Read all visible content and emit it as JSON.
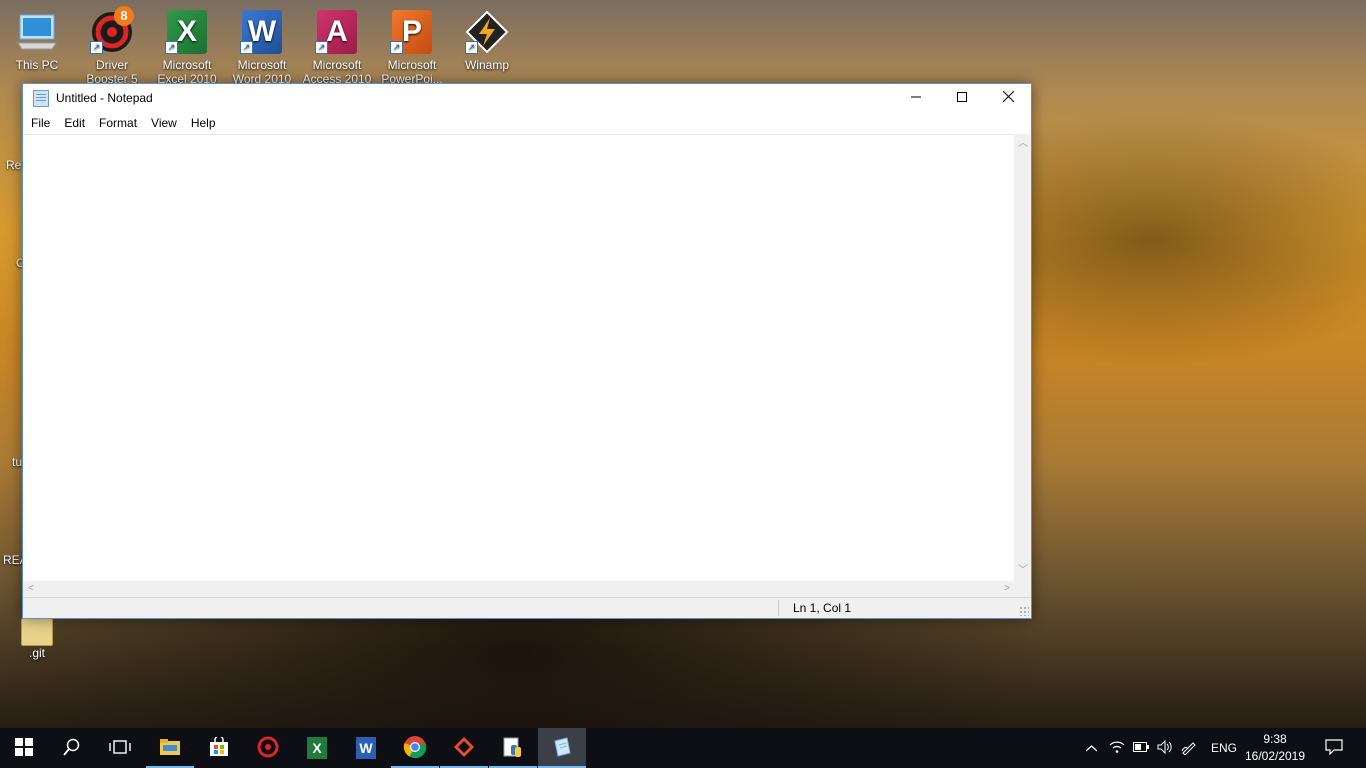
{
  "desktop": {
    "icons": [
      {
        "label": "This PC",
        "icon": "computer-icon"
      },
      {
        "label": "Driver Booster 5",
        "icon": "driver-booster-icon",
        "badge": "8"
      },
      {
        "label": "Microsoft Excel 2010",
        "icon": "excel-icon"
      },
      {
        "label": "Microsoft Word 2010",
        "icon": "word-icon"
      },
      {
        "label": "Microsoft Access 2010",
        "icon": "access-icon"
      },
      {
        "label": "Microsoft PowerPoi...",
        "icon": "powerpoint-icon"
      },
      {
        "label": "Winamp",
        "icon": "winamp-icon"
      }
    ],
    "left_partial_labels": [
      "Re",
      "C",
      "tu",
      "REA"
    ],
    "git_label": ".git"
  },
  "notepad": {
    "title": "Untitled - Notepad",
    "menu": [
      "File",
      "Edit",
      "Format",
      "View",
      "Help"
    ],
    "content": "",
    "status": "Ln 1, Col 1"
  },
  "taskbar": {
    "pinned": [
      "start-icon",
      "search-icon",
      "task-view-icon",
      "file-explorer-icon",
      "store-icon",
      "driver-booster-icon",
      "excel-icon",
      "word-icon",
      "chrome-icon",
      "git-icon",
      "python-icon",
      "notepad-icon"
    ],
    "language": "ENG",
    "time": "9:38",
    "date": "16/02/2019"
  },
  "colors": {
    "taskbar": "#0d0f14",
    "accent": "#76b9ed",
    "window_border": "#5a8fc7"
  }
}
